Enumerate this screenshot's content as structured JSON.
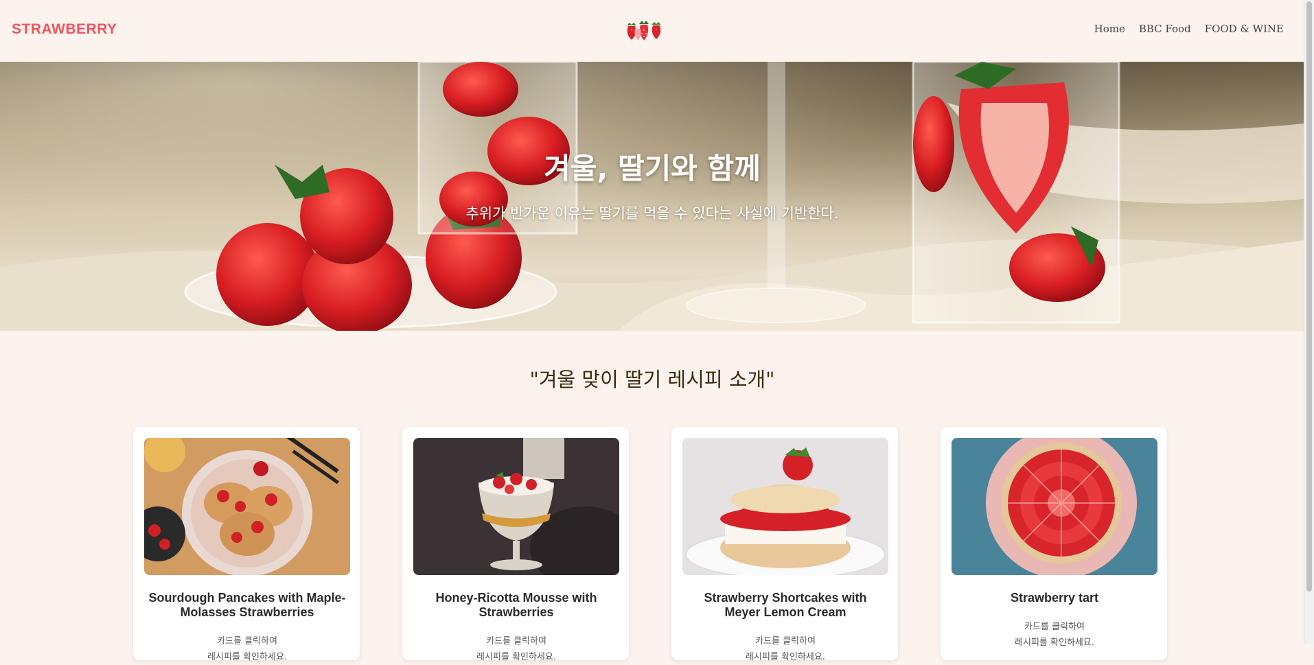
{
  "header": {
    "logo": "STRAWBERRY",
    "center_icon": "strawberry-cluster-icon",
    "nav": [
      {
        "label": "Home"
      },
      {
        "label": "BBC Food"
      },
      {
        "label": "FOOD & WINE"
      }
    ]
  },
  "hero": {
    "title": "겨울, 딸기와 함께",
    "subtitle": "추위가 반가운 이유는 딸기를 먹을 수 있다는 사실에 기반한다."
  },
  "section": {
    "title": "\"겨울 맞이 딸기 레시피 소개\""
  },
  "cards": [
    {
      "title": "Sourdough Pancakes with Maple-Molasses Strawberries",
      "line1": "카드를 클릭하여",
      "line2": "레시피를 확인하세요."
    },
    {
      "title": "Honey-Ricotta Mousse with Strawberries",
      "line1": "카드를 클릭하여",
      "line2": "레시피를 확인하세요."
    },
    {
      "title": "Strawberry Shortcakes with Meyer Lemon Cream",
      "line1": "카드를 클릭하여",
      "line2": "레시피를 확인하세요."
    },
    {
      "title": "Strawberry tart",
      "line1": "카드를 클릭하여",
      "line2": "레시피를 확인하세요."
    }
  ],
  "colors": {
    "background": "#fdf3ee",
    "brand": "#ef5560",
    "heading": "#3a2a0c"
  }
}
